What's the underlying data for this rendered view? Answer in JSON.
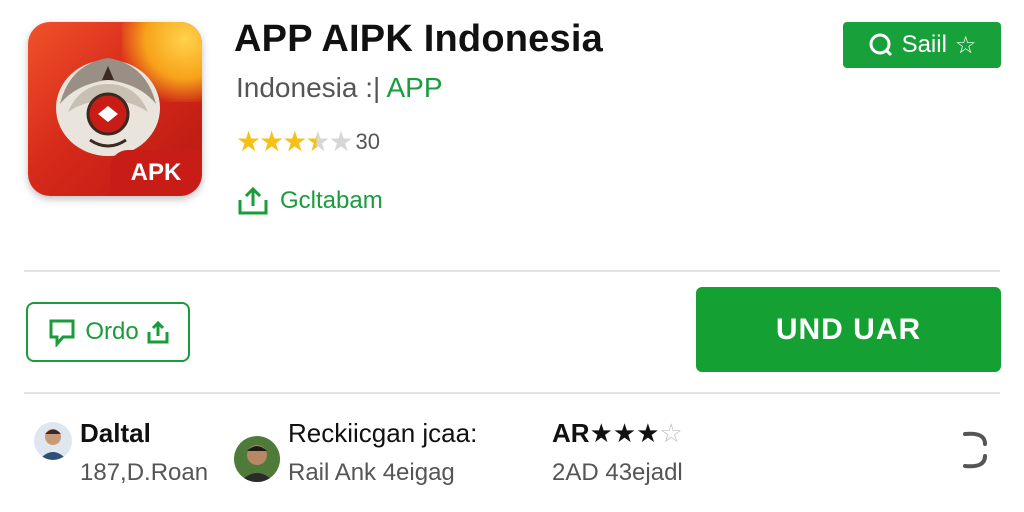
{
  "app": {
    "title": "APP AIPK Indonesia",
    "subtitle_prefix": "Indonesia :|",
    "subtitle_accent": "APP",
    "icon_tag": "APK",
    "rating_count": "30",
    "rating_value": 3.5,
    "share_label": "Gcltabam"
  },
  "header_button": {
    "label": "Saiil",
    "icon": "star-icon"
  },
  "actions": {
    "secondary_label": "Ordo",
    "install_label": "UND UAR"
  },
  "info": [
    {
      "heading": "Daltal",
      "sub": "187,D.Roan",
      "icon": "developer-avatar"
    },
    {
      "heading": "Reckiicgan jcaa:",
      "sub": "Rail Ank 4eigag",
      "icon": "reviewer-avatar"
    },
    {
      "heading_prefix": "AR",
      "stars": 3,
      "sub": "2AD 43ejadl"
    }
  ],
  "colors": {
    "accent": "#1a9b3c",
    "install": "#14a033",
    "star": "#f5c116"
  }
}
